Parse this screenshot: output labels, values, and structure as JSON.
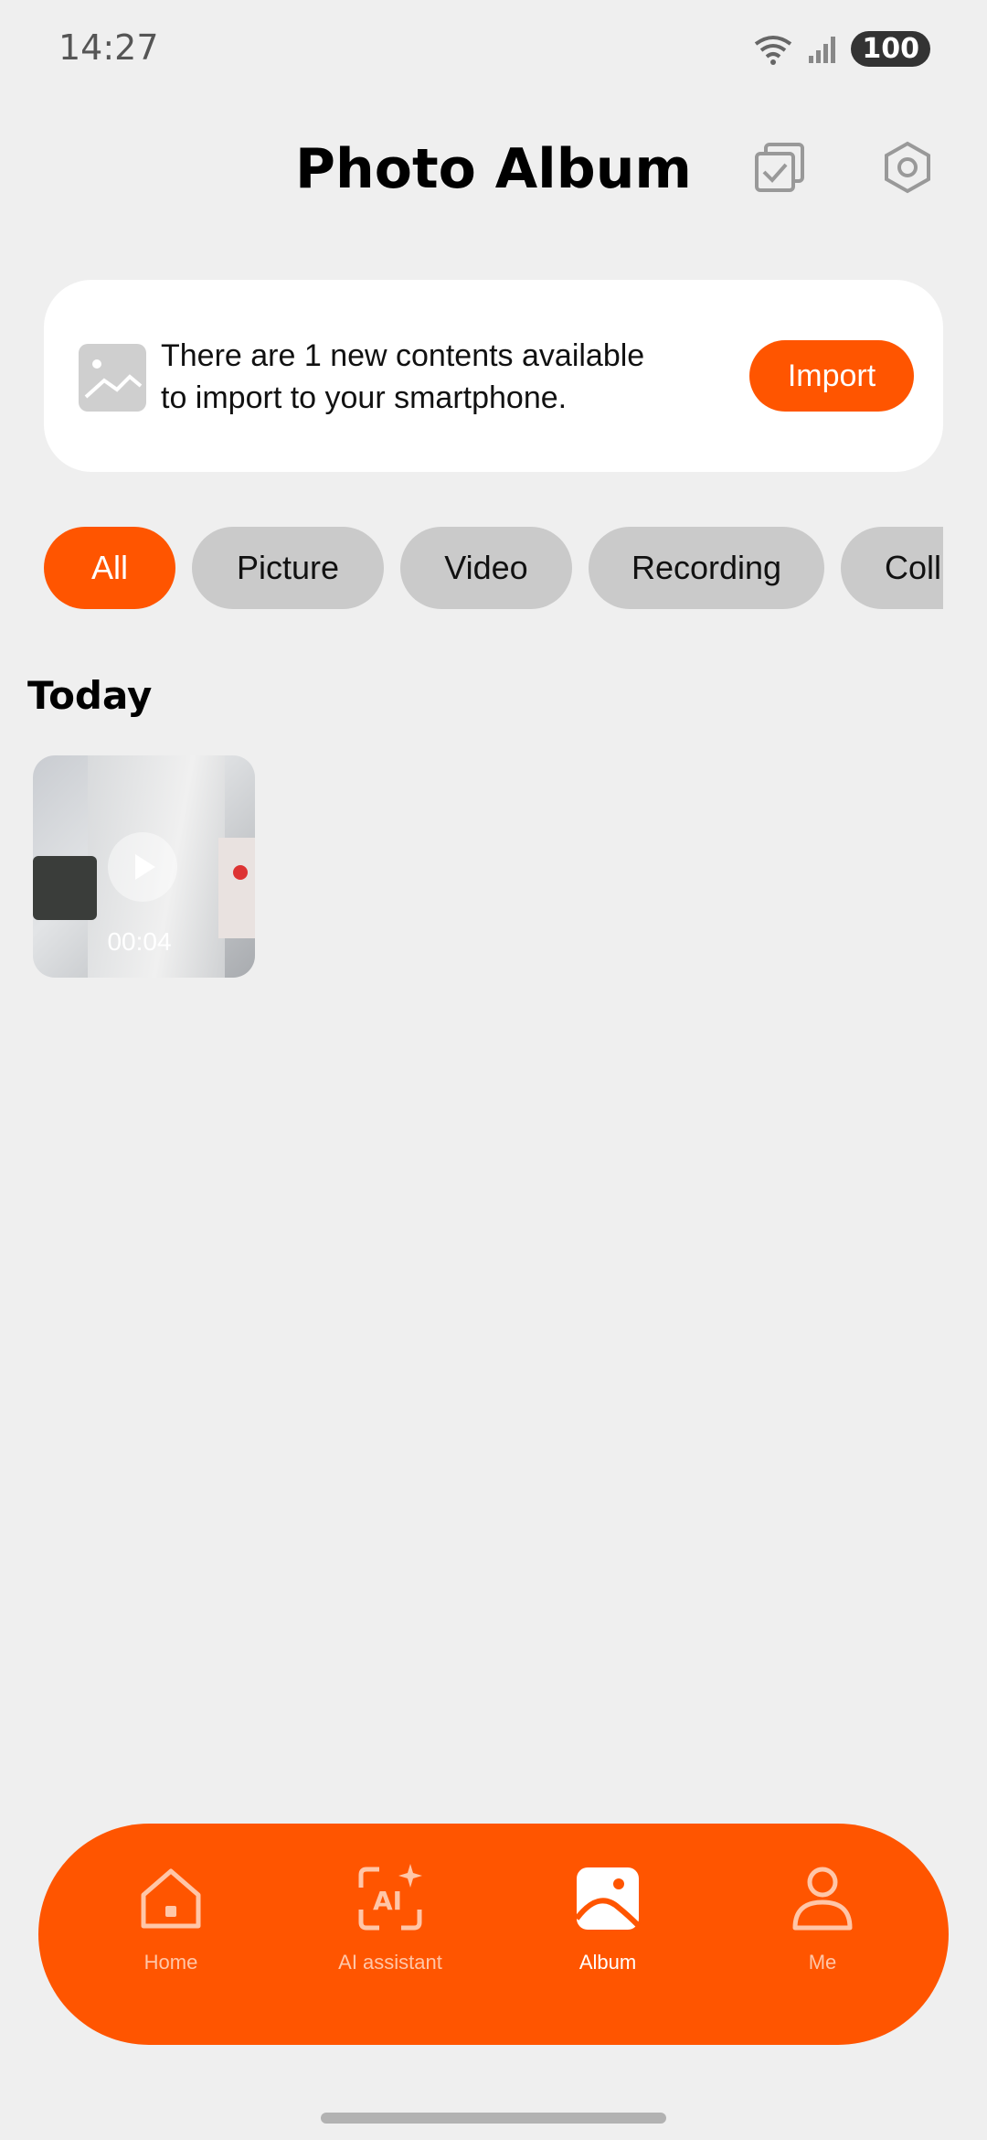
{
  "status_bar": {
    "time": "14:27",
    "battery": "100"
  },
  "header": {
    "title": "Photo Album"
  },
  "banner": {
    "message": "There are 1 new contents available to import to your smartphone.",
    "button_label": "Import"
  },
  "filters": [
    "All",
    "Picture",
    "Video",
    "Recording",
    "Coll"
  ],
  "section": {
    "title": "Today"
  },
  "media": [
    {
      "duration": "00:04"
    }
  ],
  "nav": {
    "items": [
      {
        "label": "Home"
      },
      {
        "label": "AI assistant"
      },
      {
        "label": "Album"
      },
      {
        "label": "Me"
      }
    ]
  },
  "colors": {
    "accent": "#ff5500",
    "background": "#efefef",
    "chip_inactive": "#cacaca"
  }
}
